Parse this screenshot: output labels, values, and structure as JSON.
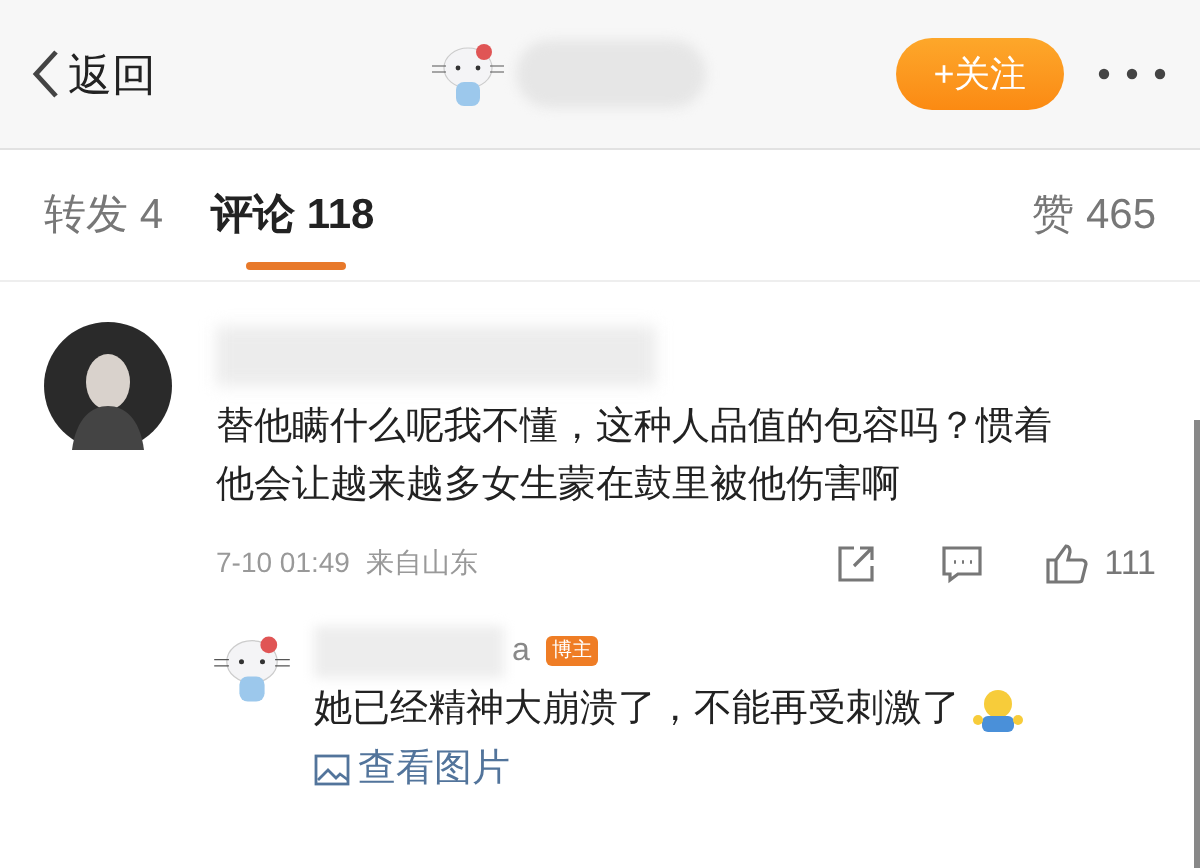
{
  "header": {
    "back": "返回",
    "follow": "+关注"
  },
  "tabs": [
    {
      "label": "转发 4",
      "selected": false
    },
    {
      "label": "评论 118",
      "selected": true
    }
  ],
  "likes": "赞 465",
  "comment": {
    "text": "替他瞒什么呢我不懂，这种人品值的包容吗？惯着他会让越来越多女生蒙在鼓里被他伤害啊",
    "time": "7-10 01:49",
    "source": "来自山东",
    "like_count": "111",
    "reply": {
      "name_tail": "a",
      "badge": "博主",
      "text": "她已经精神大崩溃了，不能再受刺激了",
      "link": "查看图片"
    }
  }
}
